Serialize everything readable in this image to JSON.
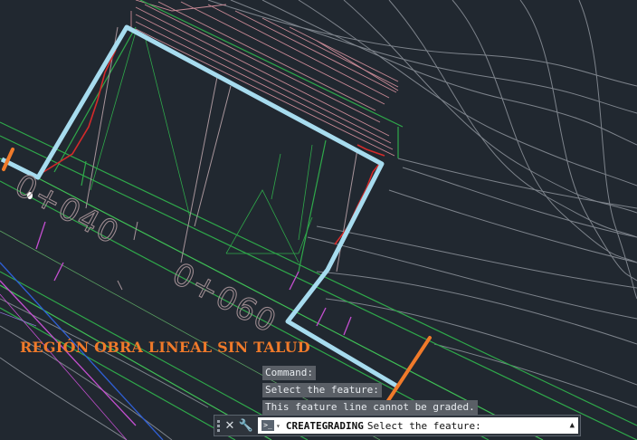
{
  "drawing": {
    "station_labels": [
      "0+040",
      "0+060"
    ],
    "annotation": "REGIÓN OBRA LINEAL SIN TALUD"
  },
  "command_history": [
    "Command:",
    "Select the feature:",
    "This feature line cannot be graded."
  ],
  "command_line": {
    "close_icon": "close-icon",
    "settings_icon": "wrench-icon",
    "prompt_icon": ">_",
    "command": "CREATEGRADING",
    "prompt": "Select the feature:"
  },
  "colors": {
    "background": "#212830",
    "feature_line": "#a7dcef",
    "annotation": "#f07a2a",
    "grading_break": "#d42a2a"
  }
}
